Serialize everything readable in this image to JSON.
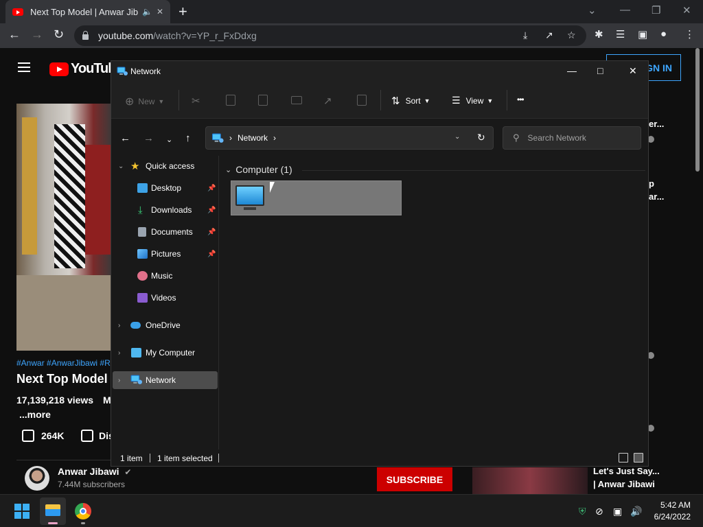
{
  "browser": {
    "tab_title": "Next Top Model | Anwar Jiba",
    "url_host": "youtube.com",
    "url_path": "/watch?v=YP_r_FxDdxg"
  },
  "youtube": {
    "logo_text": "YouTube",
    "sign_in": "SIGN IN",
    "tags": "#Anwar #AnwarJibawi #R",
    "video_title": "Next Top Model",
    "views": "17,139,218 views",
    "views_cut": "Ma",
    "more": "...more",
    "likes": "264K",
    "dislike_cut": "Dis",
    "channel": "Anwar Jibawi",
    "subscribers": "7.44M subscribers",
    "subscribe": "SUBSCRIBE",
    "side_1": "er...",
    "side_2": "p",
    "side_3": "ar...",
    "side_bottom_1": "Let's Just Say...",
    "side_bottom_2": "| Anwar Jibawi"
  },
  "explorer": {
    "window_title": "Network",
    "cmd": {
      "new": "New",
      "sort": "Sort",
      "view": "View",
      "more": "•••"
    },
    "address": {
      "location": "Network",
      "search_placeholder": "Search Network"
    },
    "nav": {
      "quick_access": "Quick access",
      "desktop": "Desktop",
      "downloads": "Downloads",
      "documents": "Documents",
      "pictures": "Pictures",
      "music": "Music",
      "videos": "Videos",
      "onedrive": "OneDrive",
      "my_computer": "My Computer",
      "network": "Network"
    },
    "group_header": "Computer (1)",
    "status": {
      "count": "1 item",
      "selected": "1 item selected"
    }
  },
  "taskbar": {
    "time": "5:42 AM",
    "date": "6/24/2022"
  },
  "colors": {
    "accent": "#3ea6ff",
    "youtube_red": "#ff0000",
    "subscribe_red": "#cc0000",
    "selection_gray": "#777777"
  }
}
